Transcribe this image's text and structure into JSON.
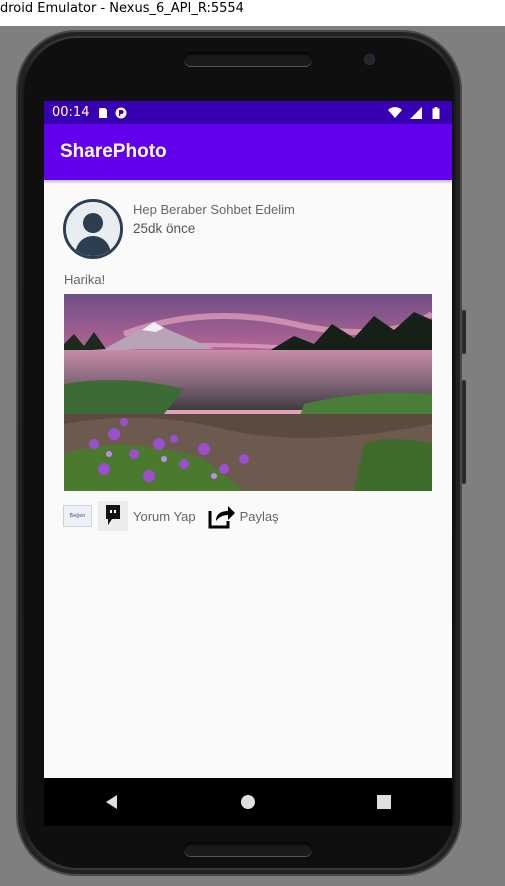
{
  "window": {
    "title": "droid Emulator - Nexus_6_API_R:5554"
  },
  "statusbar": {
    "time": "00:14"
  },
  "appbar": {
    "title": "SharePhoto"
  },
  "post": {
    "author": "Hep Beraber Sohbet Edelim",
    "time_ago": "25dk önce",
    "caption": "Harika!",
    "like_label": "Beğen",
    "comment_label": "Yorum Yap",
    "share_label": "Paylaş"
  },
  "colors": {
    "status_bar": "#3700b3",
    "app_bar": "#6200ee",
    "screen_bg": "#fafafa"
  },
  "icons": {
    "sd-card": "sd-card-icon",
    "notification": "app-notification-icon",
    "wifi": "wifi-icon",
    "signal": "signal-icon",
    "battery": "battery-icon",
    "back": "back-icon",
    "home": "home-icon",
    "recents": "recents-icon",
    "comment": "comment-icon",
    "share": "share-icon",
    "like": "like-icon",
    "avatar": "avatar-icon"
  }
}
